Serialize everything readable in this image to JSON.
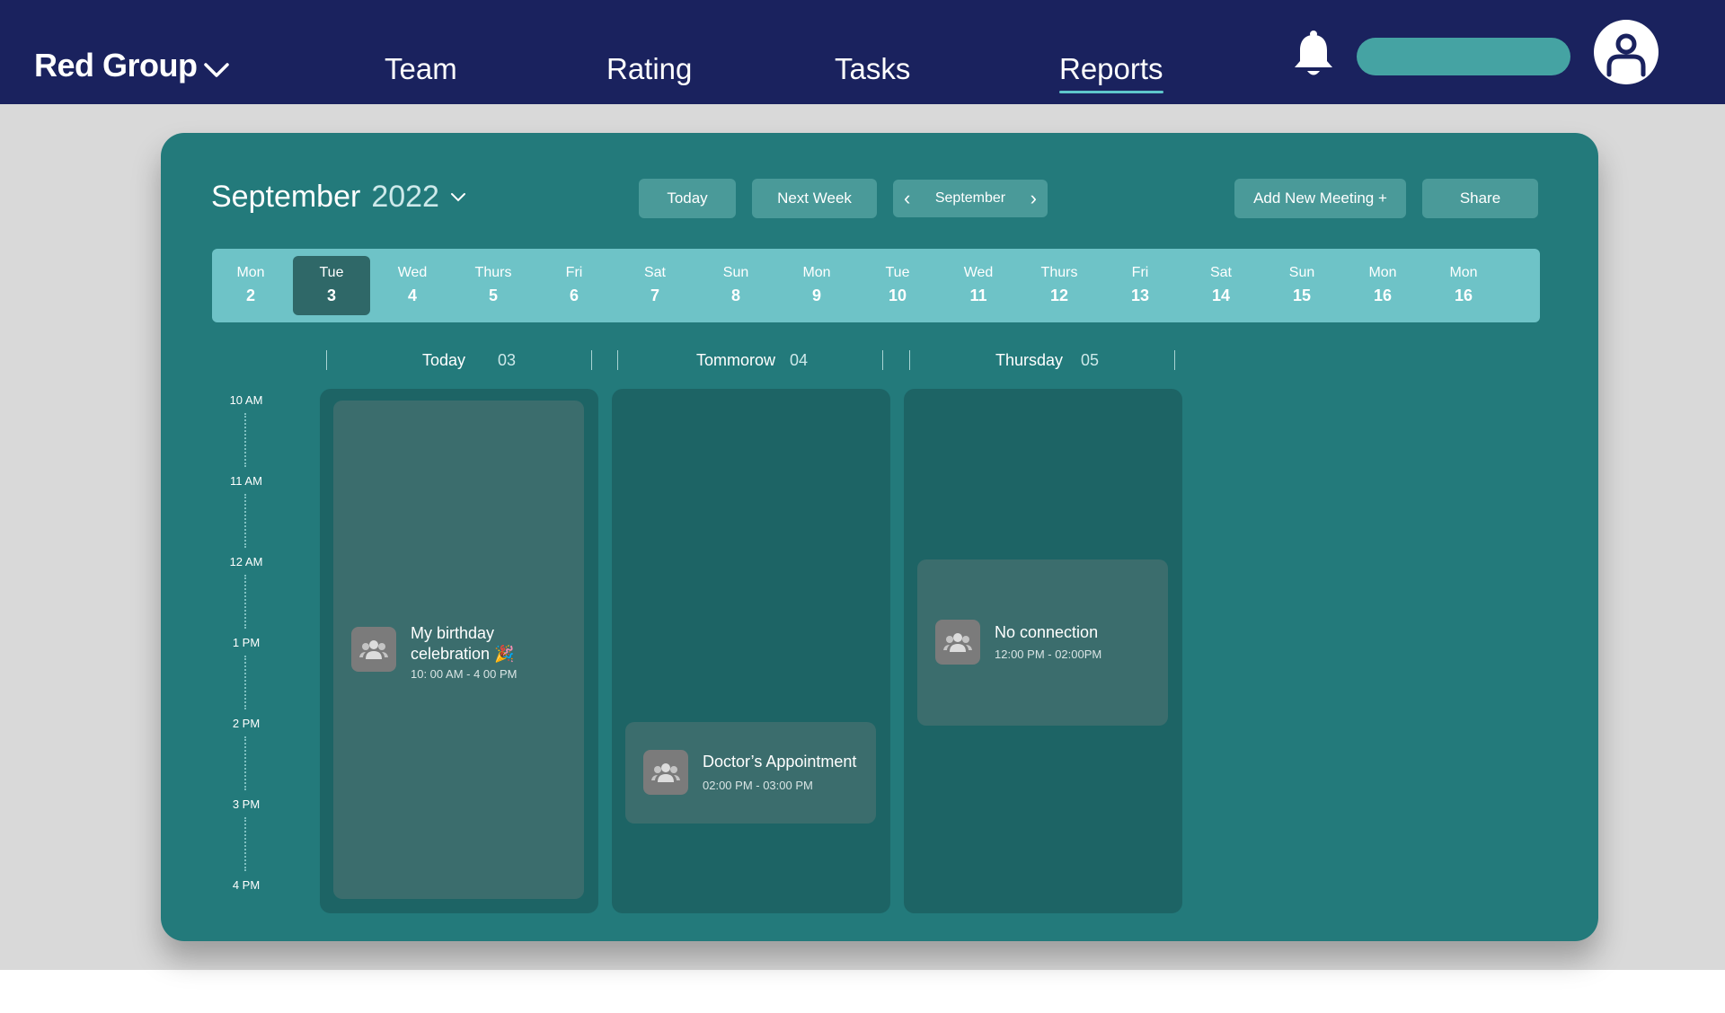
{
  "brand": {
    "name": "Red Group"
  },
  "nav": {
    "items": [
      {
        "label": "Team"
      },
      {
        "label": "Rating"
      },
      {
        "label": "Tasks"
      },
      {
        "label": "Reports",
        "active": true
      }
    ],
    "icons": {
      "notifications": "bell-icon",
      "profile": "user-icon",
      "brand_menu": "chevron-down-icon"
    }
  },
  "calendar": {
    "month": "September",
    "year": "2022",
    "buttons": {
      "today": "Today",
      "next_week": "Next Week",
      "add_meeting": "Add New Meeting +",
      "share": "Share"
    },
    "month_nav": {
      "label": "September"
    },
    "days": [
      {
        "name": "Mon",
        "num": "2"
      },
      {
        "name": "Tue",
        "num": "3",
        "selected": true
      },
      {
        "name": "Wed",
        "num": "4"
      },
      {
        "name": "Thurs",
        "num": "5"
      },
      {
        "name": "Fri",
        "num": "6"
      },
      {
        "name": "Sat",
        "num": "7"
      },
      {
        "name": "Sun",
        "num": "8"
      },
      {
        "name": "Mon",
        "num": "9"
      },
      {
        "name": "Tue",
        "num": "10"
      },
      {
        "name": "Wed",
        "num": "11"
      },
      {
        "name": "Thurs",
        "num": "12"
      },
      {
        "name": "Fri",
        "num": "13"
      },
      {
        "name": "Sat",
        "num": "14"
      },
      {
        "name": "Sun",
        "num": "15"
      },
      {
        "name": "Mon",
        "num": "16"
      },
      {
        "name": "Mon",
        "num": "16"
      }
    ],
    "columns": [
      {
        "label": "Today",
        "num": "03"
      },
      {
        "label": "Tommorow",
        "num": "04"
      },
      {
        "label": "Thursday",
        "num": "05"
      }
    ],
    "times": [
      "10 AM",
      "11 AM",
      "12 AM",
      "1 PM",
      "2 PM",
      "3 PM",
      "4 PM"
    ],
    "events": [
      {
        "title": "My birthday celebration 🎉",
        "time": "10: 00 AM - 4 00 PM",
        "icon": "group-icon"
      },
      {
        "title": "Doctor’s Appointment",
        "time": "02:00 PM -  03:00 PM",
        "icon": "group-icon"
      },
      {
        "title": "No connection",
        "time": "12:00 PM - 02:00PM",
        "icon": "group-icon"
      }
    ]
  },
  "colors": {
    "topbar": "#1a225e",
    "card": "#237a7b",
    "date_strip": "#6ec3c7",
    "selected_day": "#2f6868",
    "day_column": "#1d6465",
    "event": "#3b6d6d",
    "button": "#4a9a99",
    "search_pill": "#45a3a3"
  }
}
